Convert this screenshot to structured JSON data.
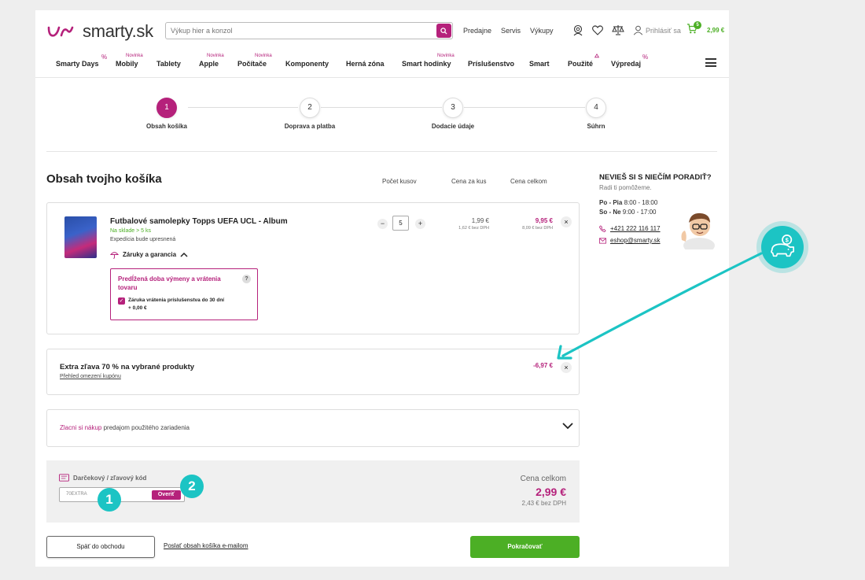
{
  "header": {
    "logo_text": "smarty.sk",
    "search_placeholder": "Výkup hier a konzol",
    "links": [
      "Predajne",
      "Servis",
      "Výkupy"
    ],
    "login_label": "Prihlásiť sa",
    "cart_count": "5",
    "cart_price": "2,99 €"
  },
  "nav": {
    "items": [
      "Smarty Days",
      "Mobily",
      "Tablety",
      "Apple",
      "Počítače",
      "Komponenty",
      "Herná zóna",
      "Smart hodinky",
      "Príslušenstvo",
      "Smart",
      "Použité",
      "Výpredaj"
    ],
    "badge": "Novinka",
    "percent": "%"
  },
  "steps": [
    {
      "num": "1",
      "label": "Obsah košíka"
    },
    {
      "num": "2",
      "label": "Doprava a platba"
    },
    {
      "num": "3",
      "label": "Dodacie údaje"
    },
    {
      "num": "4",
      "label": "Súhrn"
    }
  ],
  "cart": {
    "title": "Obsah tvojho košíka",
    "col_qty": "Počet kusov",
    "col_unit": "Cena za kus",
    "col_total": "Cena celkom",
    "product": {
      "title": "Futbalové samolepky Topps UEFA UCL - Album",
      "stock": "Na sklade > 5 ks",
      "expedition": "Expedícia bude upresnená",
      "warranty_label": "Záruky a garancia",
      "quantity": "5",
      "unit_price": "1,99 €",
      "unit_price_net": "1,62 € bez DPH",
      "total_price": "9,95 €",
      "total_price_net": "8,09 € bez DPH"
    },
    "extension": {
      "title": "Predĺžená doba výmeny a vrátenia tovaru",
      "help": "?",
      "option_label": "Záruka vrátenia príslušenstva do 30 dní",
      "option_price": "+ 0,00 €"
    },
    "coupon": {
      "title": "Extra zľava 70 % na vybrané produkty",
      "link": "Přehled omezení kupónu",
      "discount": "-6,97 €"
    },
    "resale": {
      "prefix": "Zlacni si nákup",
      "suffix": " predajom použitého zariadenia"
    },
    "gift": {
      "label": "Darčekový / zľavový kód",
      "code_value": "70EXTRA",
      "verify_label": "Overiť"
    },
    "summary": {
      "label": "Cena celkom",
      "price": "2,99 €",
      "net": "2,43 € bez DPH"
    },
    "back_label": "Späť do obchodu",
    "email_label": "Poslať obsah košíka e-mailom",
    "continue_label": "Pokračovať"
  },
  "help": {
    "title": "NEVIEŠ SI S NIEČÍM PORADIŤ?",
    "subtitle": "Radi ti pomôžeme.",
    "hours": [
      {
        "days": "Po - Pia",
        "time": " 8:00 - 18:00"
      },
      {
        "days": "So - Ne",
        "time": " 9:00 - 17:00"
      }
    ],
    "phone": "+421 222 116 117",
    "email": "eshop@smarty.sk"
  },
  "annotations": {
    "marker_1": "1",
    "marker_2": "2"
  },
  "colors": {
    "brand": "#b5217b",
    "green": "#4caf25",
    "annotation": "#1cc4c4"
  }
}
